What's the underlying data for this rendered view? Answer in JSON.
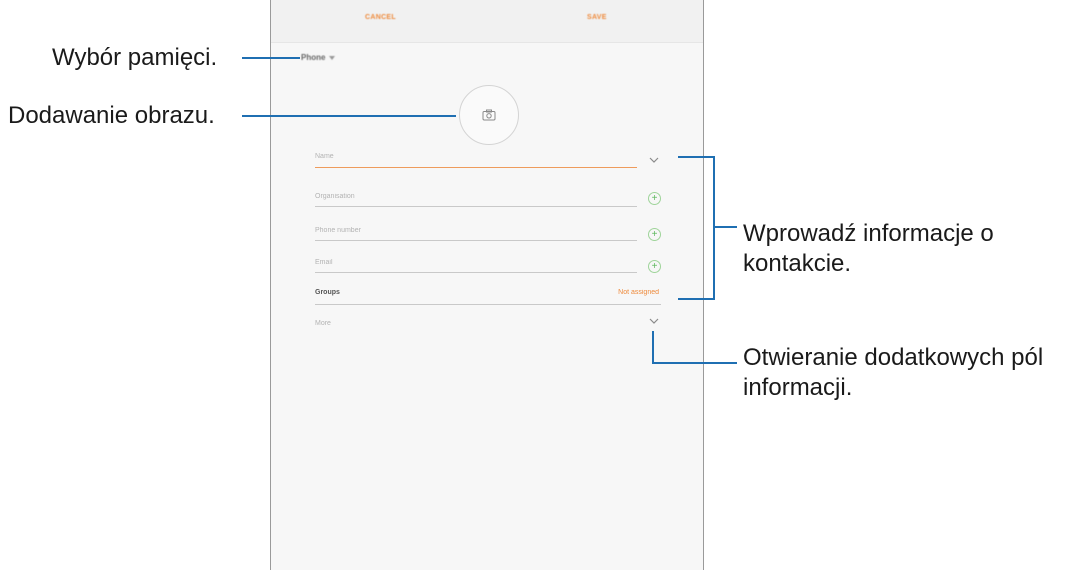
{
  "screen": {
    "topbar": {
      "cancel_label": "CANCEL",
      "save_label": "SAVE"
    },
    "storage_selector": {
      "label": "Phone",
      "icon": "caret-down-icon"
    },
    "photo": {
      "icon": "camera-icon"
    },
    "fields": [
      {
        "label": "Name",
        "icon": "chevron-down-icon"
      },
      {
        "label": "Organisation",
        "icon": "plus-icon"
      },
      {
        "label": "Phone number",
        "icon": "plus-icon"
      },
      {
        "label": "Email",
        "icon": "plus-icon"
      }
    ],
    "groups": {
      "label": "Groups",
      "value": "Not assigned"
    },
    "more": {
      "label": "More",
      "icon": "chevron-down-icon"
    }
  },
  "callouts": {
    "storage": "Wybór pamięci.",
    "image": "Dodawanie obrazu.",
    "contact_info_line1": "Wprowadź informacje o",
    "contact_info_line2": "kontakcie.",
    "more_fields_line1": "Otwieranie dodatkowych pól",
    "more_fields_line2": "informacji."
  },
  "colors": {
    "accent": "#ee8a3b",
    "callout_line": "#1f6fb2",
    "plus_green": "#5cb85c"
  }
}
